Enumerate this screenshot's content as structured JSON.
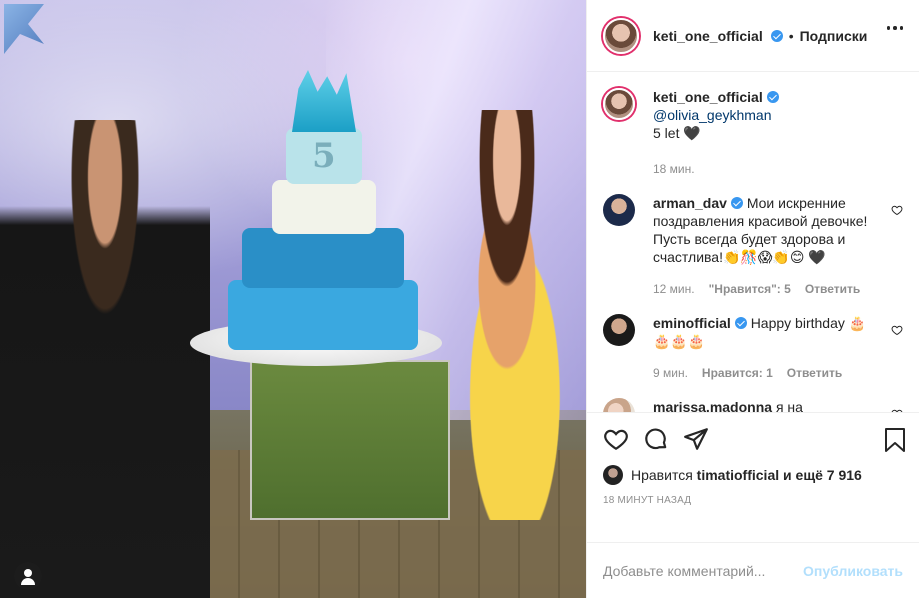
{
  "header": {
    "username": "keti_one_official",
    "separator": "•",
    "follow_label": "Подписки"
  },
  "caption": {
    "username": "keti_one_official",
    "mention": "@olivia_geykhman",
    "text": "5 let 🖤",
    "time": "18 мин."
  },
  "comments": [
    {
      "username": "arman_dav",
      "verified": true,
      "text": "Мои искренние поздравления красивой девочке! Пусть всегда будет здорова и счастлива!👏🎊😱👏😊 🖤",
      "time": "12 мин.",
      "likes": "\"Нравится\": 5",
      "reply": "Ответить"
    },
    {
      "username": "eminofficial",
      "verified": true,
      "text": "Happy birthday 🎂 🎂🎂🎂",
      "time": "9 мин.",
      "likes": "Нравится: 1",
      "reply": "Ответить"
    },
    {
      "username": "marissa.madonna",
      "verified": false,
      "text": "я на сегоНашний день с малышкой"
    }
  ],
  "likes": {
    "prefix": "Нравится",
    "user": "timatiofficial",
    "suffix": "и ещё 7 916"
  },
  "timestamp": "18 минут назад",
  "add_comment": {
    "placeholder": "Добавьте комментарий...",
    "publish": "Опубликовать"
  },
  "photo": {
    "cake_number": "5"
  },
  "colors": {
    "verified": "#3897f0",
    "publish_disabled": "#b2dffc",
    "story_ring": "#e1306c"
  }
}
